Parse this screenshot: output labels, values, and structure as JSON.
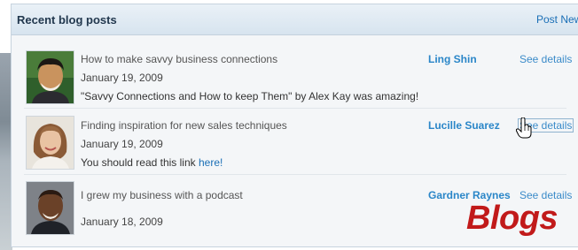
{
  "panel": {
    "title": "Recent blog posts",
    "post_new_label": "Post New"
  },
  "posts": [
    {
      "title": "How to make savvy business connections",
      "date": "January 19, 2009",
      "comment_text": "\"Savvy Connections and How to keep Them\" by Alex Kay was amazing!",
      "author": "Ling Shin",
      "details_label": "See details"
    },
    {
      "title": "Finding inspiration for new sales techniques",
      "date": "January 19, 2009",
      "comment_prefix": "You should read this link ",
      "comment_link": "here!",
      "author": "Lucille Suarez",
      "details_label": "See details"
    },
    {
      "title": "I grew my business with a podcast",
      "date": "January 18, 2009",
      "author": "Gardner Raynes",
      "details_label": "See details"
    }
  ],
  "watermark": "Blogs",
  "icons": {
    "avatar_1": "avatar-man-icon",
    "avatar_2": "avatar-woman-icon",
    "avatar_3": "avatar-man-icon",
    "cursor": "hand-pointer-icon"
  }
}
